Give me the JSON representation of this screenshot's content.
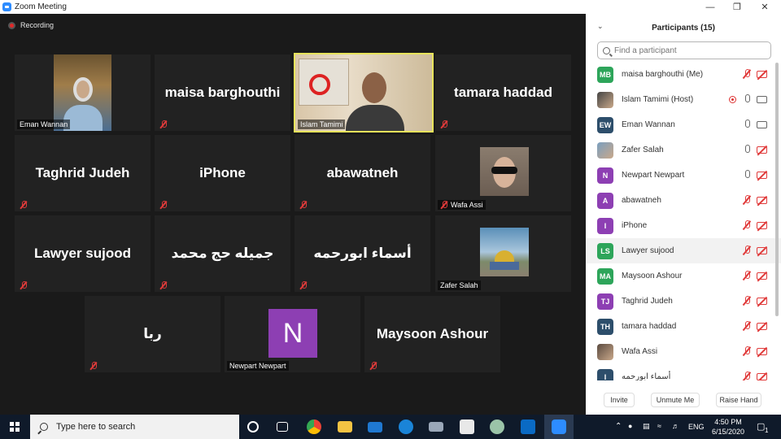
{
  "window": {
    "title": "Zoom Meeting",
    "controls": {
      "minimize": "—",
      "restore": "❐",
      "close": "✕"
    }
  },
  "meeting": {
    "recording_label": "Recording",
    "tiles": [
      {
        "id": "eman",
        "label": "Eman Wannan",
        "big_name": "",
        "muted": false,
        "video": "photo"
      },
      {
        "id": "maisa",
        "label": "",
        "big_name": "maisa barghouthi",
        "muted": true,
        "video": "none"
      },
      {
        "id": "islam",
        "label": "Islam Tamimi",
        "big_name": "",
        "muted": false,
        "video": "photo",
        "active_speaker": true
      },
      {
        "id": "tamara",
        "label": "",
        "big_name": "tamara haddad",
        "muted": true,
        "video": "none"
      },
      {
        "id": "taghrid",
        "label": "",
        "big_name": "Taghrid Judeh",
        "muted": true,
        "video": "none"
      },
      {
        "id": "iphone",
        "label": "",
        "big_name": "iPhone",
        "muted": true,
        "video": "none"
      },
      {
        "id": "abawatneh",
        "label": "",
        "big_name": "abawatneh",
        "muted": true,
        "video": "none"
      },
      {
        "id": "wafa",
        "label": "Wafa Assi",
        "big_name": "",
        "muted": true,
        "video": "profile"
      },
      {
        "id": "sujood",
        "label": "",
        "big_name": "Lawyer sujood",
        "muted": true,
        "video": "none"
      },
      {
        "id": "jamila",
        "label": "",
        "big_name": "جميله حج محمد",
        "muted": true,
        "video": "none"
      },
      {
        "id": "asmaa",
        "label": "",
        "big_name": "أسماء ابورحمه",
        "muted": true,
        "video": "none"
      },
      {
        "id": "zafer",
        "label": "Zafer Salah",
        "big_name": "",
        "muted": false,
        "video": "profile"
      },
      {
        "id": "ruba",
        "label": "",
        "big_name": "ربا",
        "muted": true,
        "video": "none"
      },
      {
        "id": "newpart",
        "label": "Newpart Newpart",
        "big_name": "",
        "muted": false,
        "video": "initial",
        "initial": "N",
        "avatar_color": "#8d3fb3"
      },
      {
        "id": "maysoon",
        "label": "",
        "big_name": "Maysoon Ashour",
        "muted": true,
        "video": "none"
      }
    ]
  },
  "participants_panel": {
    "title": "Participants (15)",
    "search_placeholder": "Find a participant",
    "participants": [
      {
        "initials": "MB",
        "color": "#2da55a",
        "name": "maisa barghouthi (Me)",
        "mic": "muted",
        "camera": "off",
        "avatar": "initials"
      },
      {
        "initials": "",
        "color": "#444444",
        "name": "Islam Tamimi (Host)",
        "mic": "on",
        "camera": "on",
        "avatar": "photo",
        "recording": true
      },
      {
        "initials": "EW",
        "color": "#2d4e6b",
        "name": "Eman Wannan",
        "mic": "on",
        "camera": "on",
        "avatar": "initials"
      },
      {
        "initials": "",
        "color": "#7a9fbf",
        "name": "Zafer Salah",
        "mic": "on",
        "camera": "off",
        "avatar": "photo"
      },
      {
        "initials": "N",
        "color": "#8d3fb3",
        "name": "Newpart Newpart",
        "mic": "on",
        "camera": "off",
        "avatar": "initials"
      },
      {
        "initials": "A",
        "color": "#8d3fb3",
        "name": "abawatneh",
        "mic": "muted",
        "camera": "off",
        "avatar": "initials"
      },
      {
        "initials": "I",
        "color": "#8d3fb3",
        "name": "iPhone",
        "mic": "muted",
        "camera": "off",
        "avatar": "initials"
      },
      {
        "initials": "LS",
        "color": "#2da55a",
        "name": "Lawyer sujood",
        "mic": "muted",
        "camera": "off",
        "avatar": "initials",
        "hover": true
      },
      {
        "initials": "MA",
        "color": "#2da55a",
        "name": "Maysoon Ashour",
        "mic": "muted",
        "camera": "off",
        "avatar": "initials"
      },
      {
        "initials": "TJ",
        "color": "#8d3fb3",
        "name": "Taghrid Judeh",
        "mic": "muted",
        "camera": "off",
        "avatar": "initials"
      },
      {
        "initials": "TH",
        "color": "#2d4e6b",
        "name": "tamara haddad",
        "mic": "muted",
        "camera": "off",
        "avatar": "initials"
      },
      {
        "initials": "",
        "color": "#5a4a40",
        "name": "Wafa Assi",
        "mic": "muted",
        "camera": "off",
        "avatar": "photo"
      },
      {
        "initials": "I",
        "color": "#2d4e6b",
        "name": "أسماء ابورحمه",
        "mic": "muted",
        "camera": "off",
        "avatar": "initials"
      }
    ],
    "footer": {
      "invite": "Invite",
      "unmute_me": "Unmute Me",
      "raise_hand": "Raise Hand"
    }
  },
  "taskbar": {
    "search_placeholder": "Type here to search",
    "language": "ENG",
    "time": "4:50 PM",
    "date": "6/15/2020",
    "notification_count": "1"
  }
}
